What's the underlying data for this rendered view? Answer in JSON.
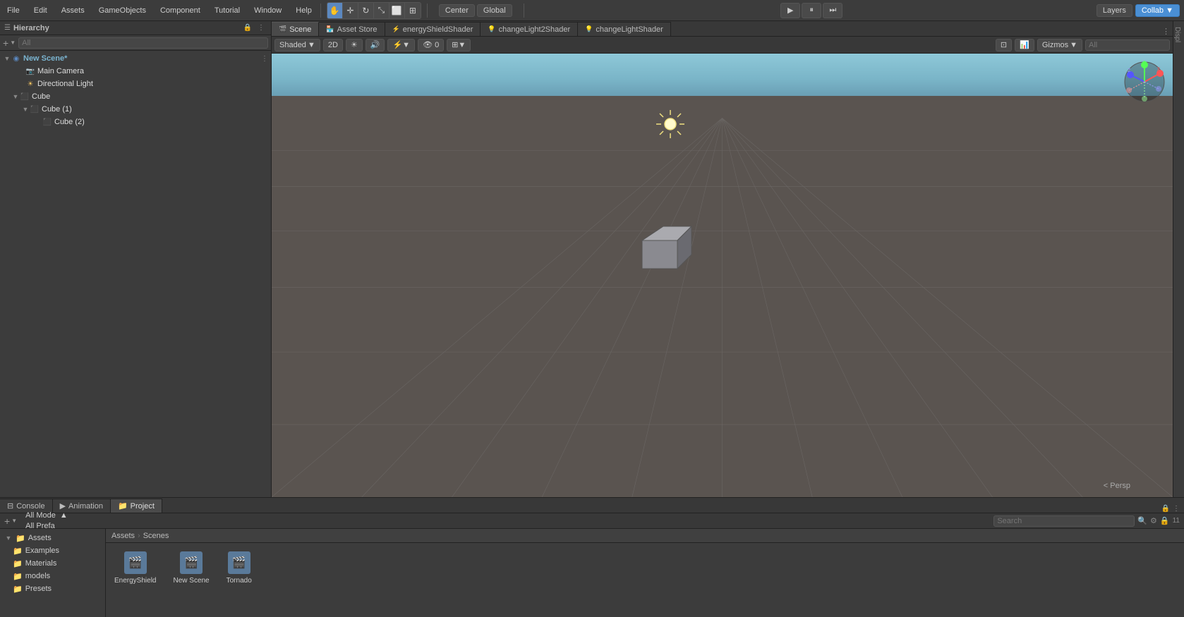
{
  "menubar": {
    "items": [
      "File",
      "Edit",
      "Assets",
      "GameObjects",
      "Component",
      "Tutorial",
      "Window",
      "Help"
    ]
  },
  "toolbar": {
    "center_dropdown1": "Center",
    "center_dropdown2": "Global",
    "play_button": "▶",
    "pause_button": "⏸",
    "step_button": "⏭",
    "layers_label": "Layers",
    "collab_label": "Collab ▼"
  },
  "hierarchy": {
    "title": "Hierarchy",
    "search_placeholder": "All",
    "scene_name": "New Scene*",
    "items": [
      {
        "label": "Main Camera",
        "level": 2,
        "type": "camera",
        "indent": 24
      },
      {
        "label": "Directional Light",
        "level": 2,
        "type": "light",
        "indent": 24
      },
      {
        "label": "Cube",
        "level": 2,
        "type": "cube",
        "indent": 24,
        "has_children": true
      },
      {
        "label": "Cube (1)",
        "level": 3,
        "type": "cube",
        "indent": 38,
        "has_children": true
      },
      {
        "label": "Cube (2)",
        "level": 4,
        "type": "cube",
        "indent": 52
      }
    ]
  },
  "tabs": [
    {
      "label": "Scene",
      "icon": "🎬",
      "active": true
    },
    {
      "label": "Asset Store",
      "icon": "🏪",
      "active": false
    },
    {
      "label": "energyShieldShader",
      "icon": "⚡",
      "active": false
    },
    {
      "label": "changeLight2Shader",
      "icon": "💡",
      "active": false
    },
    {
      "label": "changeLightShader",
      "icon": "💡",
      "active": false
    }
  ],
  "scene_toolbar": {
    "shaded_label": "Shaded",
    "twod_label": "2D",
    "gizmos_label": "Gizmos",
    "all_search_placeholder": "All",
    "persp_label": "< Persp"
  },
  "viewport": {
    "grid_color": "#888",
    "sky_color_top": "#8ec8d8",
    "sky_color_bottom": "#6a9fb5",
    "ground_color": "#5a5450"
  },
  "orientation": {
    "x_label": "X",
    "y_label": "Y",
    "z_label": "Z"
  },
  "bottom_tabs": [
    {
      "label": "Console",
      "icon": "⊟",
      "active": false
    },
    {
      "label": "Animation",
      "icon": "▶",
      "active": false
    },
    {
      "label": "Project",
      "icon": "📁",
      "active": true
    }
  ],
  "project": {
    "search_placeholder": "Search",
    "modes": [
      "All Mode",
      "All Prefa"
    ],
    "breadcrumb": [
      "Assets",
      "Scenes"
    ],
    "sidebar": {
      "items": [
        {
          "label": "Assets",
          "type": "folder",
          "expanded": true
        },
        {
          "label": "Examples",
          "type": "folder",
          "indent": 12
        },
        {
          "label": "Materials",
          "type": "folder",
          "indent": 12
        },
        {
          "label": "models",
          "type": "folder",
          "indent": 12
        },
        {
          "label": "Presets",
          "type": "folder",
          "indent": 12
        }
      ]
    },
    "files": [
      {
        "label": "EnergyShield",
        "icon": "🎬"
      },
      {
        "label": "New Scene",
        "icon": "🎬"
      },
      {
        "label": "Tornado",
        "icon": "🎬"
      }
    ]
  }
}
